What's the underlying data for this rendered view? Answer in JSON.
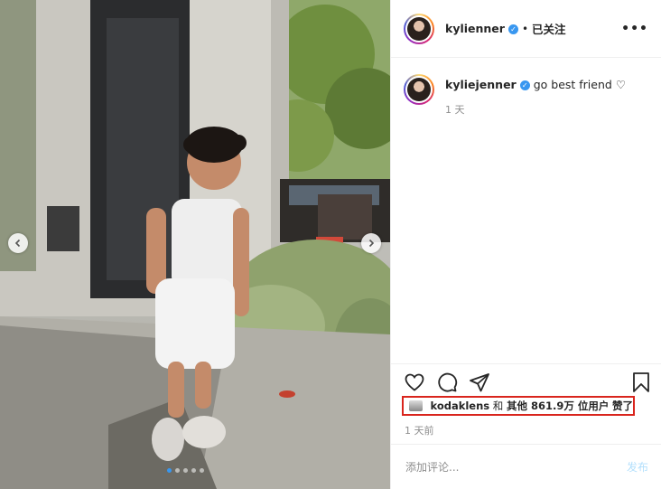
{
  "post": {
    "username": "kylienner",
    "verified_mark": "✓",
    "dot": "•",
    "follow_status": "已关注",
    "more_label": "•••"
  },
  "caption": {
    "username": "kyliejenner",
    "text": "go best friend",
    "heart": "♡",
    "time": "1 天"
  },
  "likes": {
    "liker": "kodaklens",
    "conj": "和",
    "others": "其他 861.9万 位用户",
    "suffix": "赞了"
  },
  "timestamp": "1 天前",
  "comment": {
    "placeholder": "添加评论...",
    "post_label": "发布"
  },
  "carousel": {
    "slides": 5,
    "active": 1
  },
  "colors": {
    "accent": "#3897f0",
    "highlight_border": "#d9251d",
    "post_disabled": "#b2dffc"
  },
  "icons": [
    "heart-icon",
    "comment-icon",
    "share-icon",
    "bookmark-icon",
    "chevron-left-icon",
    "chevron-right-icon"
  ]
}
